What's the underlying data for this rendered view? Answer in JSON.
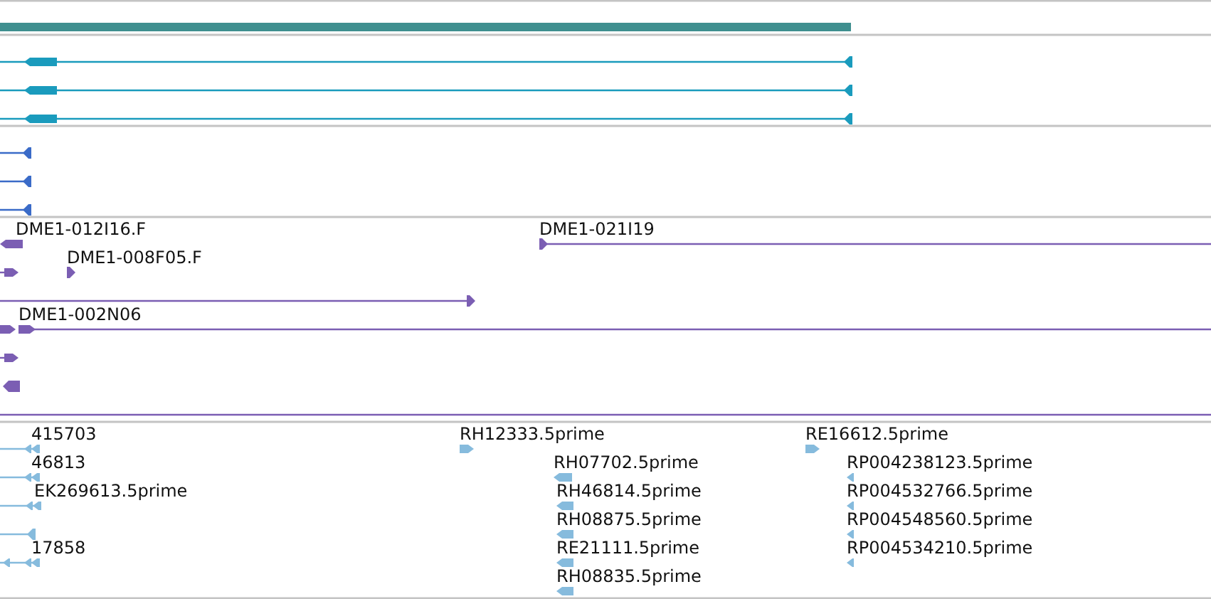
{
  "tracks": [
    {
      "kind": "coverage"
    },
    {
      "kind": "transcripts",
      "features": [
        {
          "reverse": true
        },
        {
          "reverse": true
        },
        {
          "reverse": true
        }
      ]
    },
    {
      "kind": "genes",
      "features": [
        {
          "reverse": true
        },
        {
          "reverse": true
        },
        {
          "reverse": true
        }
      ]
    },
    {
      "kind": "clones",
      "features": [
        {
          "label": "DME1-012I16.F",
          "reverse": true
        },
        {
          "label": "DME1-021I19",
          "reverse": false
        },
        {
          "reverse": false
        },
        {
          "label": "DME1-008F05.F",
          "reverse": false
        },
        {
          "reverse": false
        },
        {
          "label": "DME1-002N06",
          "reverse": false
        },
        {
          "reverse": false
        },
        {
          "reverse": true
        }
      ]
    },
    {
      "kind": "ests",
      "features": [
        {
          "label": "415703",
          "reverse": true
        },
        {
          "label": "46813",
          "reverse": true
        },
        {
          "label": "EK269613.5prime",
          "reverse": true
        },
        {
          "reverse": true
        },
        {
          "label": "17858",
          "reverse": true
        },
        {
          "label": "RH12333.5prime",
          "reverse": false
        },
        {
          "label": "RE16612.5prime",
          "reverse": false
        },
        {
          "label": "RH07702.5prime",
          "reverse": true
        },
        {
          "label": "RH46814.5prime",
          "reverse": true
        },
        {
          "label": "RH08875.5prime",
          "reverse": true
        },
        {
          "label": "RE21111.5prime",
          "reverse": true
        },
        {
          "label": "RH08835.5prime",
          "reverse": true
        },
        {
          "label": "RP004238123.5prime",
          "reverse": true
        },
        {
          "label": "RP004532766.5prime",
          "reverse": true
        },
        {
          "label": "RP004548560.5prime",
          "reverse": true
        },
        {
          "label": "RP004534210.5prime",
          "reverse": true
        }
      ]
    }
  ]
}
